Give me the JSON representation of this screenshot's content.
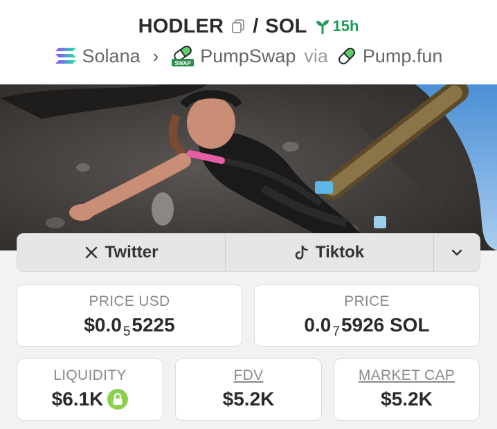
{
  "header": {
    "token_symbol": "HODLER",
    "separator": "/",
    "quote_symbol": "SOL",
    "age": "15h",
    "chain": "Solana",
    "dex": "PumpSwap",
    "via": "via",
    "launchpad": "Pump.fun",
    "dex_badge_text": "SWAP"
  },
  "social": {
    "twitter_label": "Twitter",
    "tiktok_label": "Tiktok"
  },
  "stats": {
    "price_usd_label": "PRICE USD",
    "price_usd_prefix": "$0.0",
    "price_usd_zeros": "5",
    "price_usd_digits": "5225",
    "price_label": "PRICE",
    "price_prefix": "0.0",
    "price_zeros": "7",
    "price_digits": "5926 SOL",
    "liquidity_label": "LIQUIDITY",
    "liquidity_value": "$6.1K",
    "fdv_label": "FDV",
    "fdv_value": "$5.2K",
    "mcap_label": "MARKET CAP",
    "mcap_value": "$5.2K"
  },
  "colors": {
    "accent_green": "#1f9b56",
    "lock_green": "#8ccf4d",
    "solana_gradient": [
      "#9945ff",
      "#14f195"
    ]
  },
  "icons": {
    "copy": "copy-icon",
    "age": "sprout-icon",
    "chain": "solana-icon",
    "dex": "pumpswap-icon",
    "launchpad": "pill-icon",
    "twitter": "x-icon",
    "tiktok": "tiktok-icon",
    "more": "chevron-down-icon",
    "liquidity_lock": "lock-icon"
  }
}
